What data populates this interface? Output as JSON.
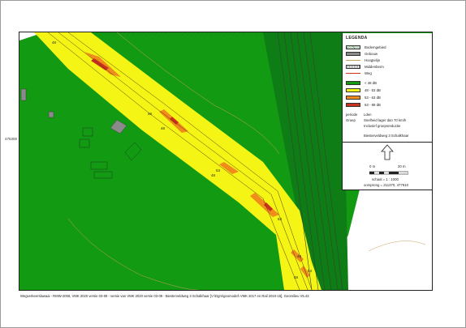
{
  "map": {
    "y_label": "475300",
    "footer": "Wegverkeerslawaai - RMW-2006, VMK 2020 versie 03-09 - versie van VMK 2020 versie 03-09 - Biesterveldweg 3 Schalkhaar [V:\\Dgm\\geomodel\\ VMK 2017 en Rail 2010-15], Geomilieu V5.43",
    "contour_labels": [
      "48",
      "48",
      "48",
      "53",
      "48",
      "53",
      "53",
      "48",
      "48"
    ],
    "colors": {
      "green": "#139a13",
      "yellow": "#f5f515",
      "orange": "#f08c1c",
      "red": "#c8321e",
      "building": "#8a8a8a"
    }
  },
  "legend": {
    "title": "LEGENDA",
    "items": [
      {
        "label": "Bodemgebied",
        "icon": "hatched-area-icon"
      },
      {
        "label": "Gebouw",
        "icon": "grey-building-icon"
      },
      {
        "label": "Hoogtelijn",
        "icon": "contour-line-icon"
      },
      {
        "label": "Middenberm",
        "icon": "median-strip-icon"
      },
      {
        "label": "Weg",
        "icon": "road-line-icon"
      }
    ],
    "classes": [
      {
        "label": "< 48 dB",
        "color": "#139a13"
      },
      {
        "label": "48 - 53 dB",
        "color": "#f5f515"
      },
      {
        "label": "53 - 63 dB",
        "color": "#f08c1c"
      },
      {
        "label": "63 - 99 dB",
        "color": "#c8321e"
      }
    ],
    "meta": [
      {
        "key": "periode",
        "value": "Lden"
      },
      {
        "key": "Groep",
        "value": "Snelheid lager dan 70 km/h"
      },
      {
        "key": "",
        "value": "Inclusief groepsreductie"
      },
      {
        "key": "",
        "value": "Biesterveldweg 3 Schalkhaar"
      }
    ],
    "scale": {
      "left": "0 m",
      "right": "20 m",
      "ratio": "schaal = 1 : 1000",
      "origin": "oorsprong = 211370, 477910"
    }
  }
}
